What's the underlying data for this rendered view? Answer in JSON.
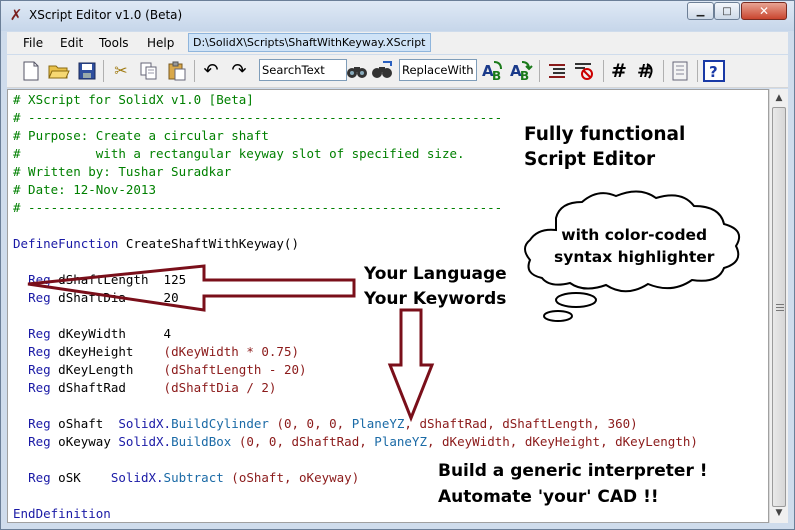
{
  "window": {
    "title": "XScript Editor v1.0 (Beta)",
    "app_icon": "x-logo-icon",
    "controls": {
      "minimize": "minimize-icon",
      "maximize": "maximize-icon",
      "close": "close-icon"
    }
  },
  "menu": {
    "items": [
      "File",
      "Edit",
      "Tools",
      "Help"
    ],
    "path": "D:\\SolidX\\Scripts\\ShaftWithKeyway.XScript"
  },
  "toolbar": {
    "icons": [
      "new-file-icon",
      "open-folder-icon",
      "save-icon",
      "cut-icon",
      "copy-icon",
      "paste-icon",
      "undo-icon",
      "redo-icon"
    ],
    "search_value": "SearchText",
    "find_icons": [
      "find-icon",
      "find-next-icon"
    ],
    "replace_value": "ReplaceWith",
    "replace_icons": [
      "replace-icon",
      "replace-all-icon",
      "indent-icon",
      "unindent-icon",
      "comment-icon",
      "uncomment-icon",
      "list-icon",
      "help-icon"
    ]
  },
  "code": {
    "comment1": "# XScript for SolidX v1.0 [Beta]",
    "comment2": "# ---------------------------------------------------------------",
    "comment3": "# Purpose: Create a circular shaft",
    "comment4": "#          with a rectangular keyway slot of specified size.",
    "comment5": "# Written by: Tushar Suradkar",
    "comment6": "# Date: 12-Nov-2013",
    "comment7": "# ---------------------------------------------------------------",
    "def_kw": "DefineFunction",
    "def_name": "CreateShaftWithKeyway()",
    "reg": "Reg",
    "v1": "dShaftLength",
    "n1": "125",
    "v2": "dShaftDia",
    "n2": "20",
    "v3": "dKeyWidth",
    "n3": "4",
    "v4": "dKeyHeight",
    "e4": "(dKeyWidth * 0.75)",
    "v5": "dKeyLength",
    "e5": "(dShaftLength - 20)",
    "v6": "dShaftRad",
    "e6": "(dShaftDia / 2)",
    "v7": "oShaft",
    "ns": "SolidX.",
    "m7": "BuildCylinder",
    "a7a": "(0, 0, 0, ",
    "c7": "PlaneYZ",
    "a7b": ", dShaftRad, dShaftLength, 360)",
    "v8": "oKeyway",
    "m8": "BuildBox",
    "a8a": "(0, 0, dShaftRad, ",
    "c8": "PlaneYZ",
    "a8b": ", dKeyWidth, dKeyHeight, dKeyLength)",
    "v9": "oSK",
    "m9": "Subtract",
    "a9": "(oShaft, oKeyway)",
    "end_kw": "EndDefinition"
  },
  "annotations": {
    "top_line1": "Fully functional",
    "top_line2": "Script Editor",
    "cloud_line1": "with color-coded",
    "cloud_line2": "syntax highlighter",
    "lang_line1": "Your Language",
    "lang_line2": "Your Keywords",
    "bottom_line1": "Build a generic interpreter !",
    "bottom_line2": "Automate 'your' CAD !!"
  },
  "colors": {
    "comment": "#008000",
    "keyword": "#1a1aa6",
    "arrow": "#7a0f1a",
    "title_bar": "#cfdcec",
    "close_button": "#c9452f"
  }
}
